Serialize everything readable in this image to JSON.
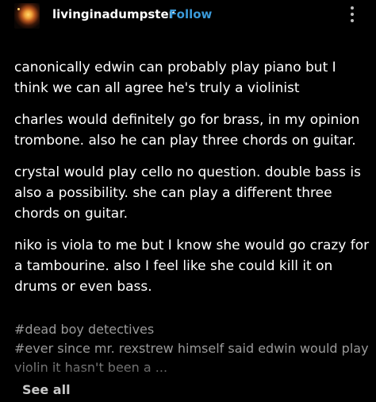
{
  "header": {
    "username": "livinginadumpster",
    "follow_label": "Follow",
    "avatar_icon": "fire-avatar-icon",
    "more_icon": "vertical-ellipsis-icon"
  },
  "post": {
    "paragraphs": [
      "canonically edwin can probably play piano but I think we can all agree he's truly a violinist",
      "charles would definitely go for brass, in my opinion trombone. also he can play three chords on guitar.",
      "crystal would play cello no question. double bass is also a possibility. she can play a different three chords on guitar.",
      "niko is viola to me but I know she would go crazy for a tambourine. also I feel like she could kill it on drums or even bass."
    ]
  },
  "tags": {
    "items": [
      "#dead boy detectives",
      "#ever since mr. rexstrew himself said edwin would play violin it hasn't been a ..."
    ]
  },
  "footer": {
    "see_all_label": "See all"
  },
  "colors": {
    "background": "#000000",
    "text": "#ffffff",
    "accent": "#3a99d8",
    "tags": "#9a9a9a"
  }
}
